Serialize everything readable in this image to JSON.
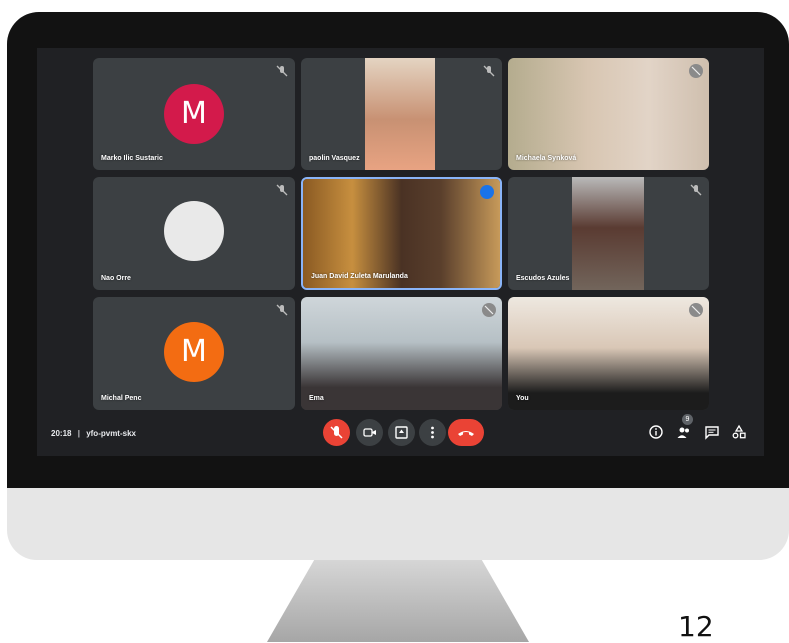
{
  "meeting": {
    "time": "20:18",
    "separator": "|",
    "code": "yfo-pvmt-skx"
  },
  "participants": [
    {
      "name": "Marko Ilic Sustaric",
      "initial": "M",
      "avatar_color": "#d31a4b",
      "muted": true
    },
    {
      "name": "paolin Vasquez",
      "muted": true
    },
    {
      "name": "Michaela Synková",
      "muted": true
    },
    {
      "name": "Nao Orre",
      "muted": true
    },
    {
      "name": "Juan David Zuleta Marulanda",
      "speaking": true
    },
    {
      "name": "Escudos Azules",
      "muted": true
    },
    {
      "name": "Michal Penc",
      "initial": "M",
      "avatar_color": "#f36c12",
      "muted": true
    },
    {
      "name": "Ema",
      "muted": true
    },
    {
      "name": "You",
      "muted": true
    }
  ],
  "toolbar": {
    "buttons": [
      "mic-off-icon",
      "camera-icon",
      "present-icon",
      "more-icon",
      "end-call-icon"
    ],
    "right_icons": [
      "info-icon",
      "people-icon",
      "chat-icon",
      "activities-icon"
    ],
    "people_badge": "9"
  },
  "colors": {
    "end_call": "#ea4335",
    "speaking": "#1a73e8",
    "screen_bg": "#202124",
    "tile_bg": "#3c4043"
  },
  "page_number": "12"
}
